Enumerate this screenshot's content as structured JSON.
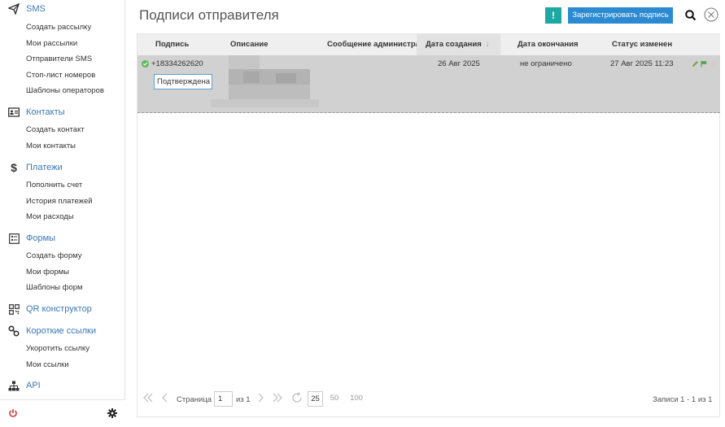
{
  "sidebar": {
    "sms": {
      "label": "SMS",
      "items": [
        "Создать рассылку",
        "Мои рассылки",
        "Отправители SMS",
        "Стоп-лист номеров",
        "Шаблоны операторов"
      ]
    },
    "contacts": {
      "label": "Контакты",
      "items": [
        "Создать контакт",
        "Мои контакты"
      ]
    },
    "payments": {
      "label": "Платежи",
      "items": [
        "Пополнить счет",
        "История платежей",
        "Мои расходы"
      ]
    },
    "forms": {
      "label": "Формы",
      "items": [
        "Создать форму",
        "Мои формы",
        "Шаблоны форм"
      ]
    },
    "qr": {
      "label": "QR конструктор"
    },
    "links": {
      "label": "Короткие ссылки",
      "items": [
        "Укоротить ссылку",
        "Мои ссылки"
      ]
    },
    "api": {
      "label": "API"
    }
  },
  "header": {
    "title": "Подписи отправителя",
    "warn_label": "!",
    "register_label": "Зарегистрировать подпись"
  },
  "table": {
    "columns": [
      "Подпись",
      "Описание",
      "Сообщение администратора",
      "Дата создания",
      "Дата окончания",
      "Статус изменен"
    ],
    "sort_arrow": "↓",
    "rows": [
      {
        "signature": "+18334262620",
        "status": "Подтверждена",
        "created": "26 Авг 2025",
        "expires": "не ограничено",
        "status_changed": "27 Авг 2025 11:23"
      }
    ]
  },
  "pager": {
    "page_label": "Страница",
    "page_value": "1",
    "of_label": "из 1",
    "sizes": [
      "25",
      "50",
      "100"
    ],
    "records": "Записи 1 - 1 из 1"
  },
  "colors": {
    "accent": "#2b8ad1",
    "teal": "#1ea8a4",
    "row": "#d1d1d1",
    "success": "#5cb85c"
  }
}
